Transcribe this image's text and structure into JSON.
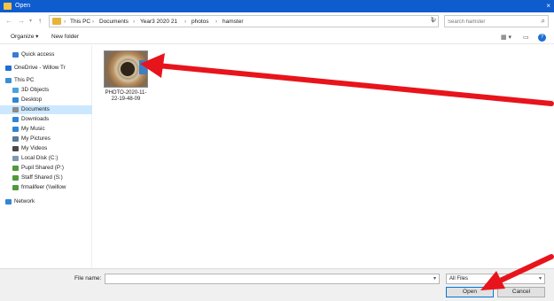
{
  "window": {
    "title": "Open",
    "close_glyph": "×"
  },
  "nav": {
    "back": "←",
    "forward": "→",
    "recent": "▾",
    "up": "↑"
  },
  "breadcrumb": [
    "This PC",
    "Documents",
    "Year3 2020 21",
    "photos",
    "hamster"
  ],
  "breadcrumb_sep": "›",
  "search": {
    "placeholder": "Search hamster"
  },
  "toolbar": {
    "organize": "Organize ▾",
    "new_folder": "New folder",
    "view_glyph": "▦ ▾",
    "pane_glyph": "▭",
    "help_glyph": "?"
  },
  "sidebar": {
    "items": [
      {
        "label": "Quick access",
        "icon": "star-icon",
        "color": "#3a7bd5"
      },
      {
        "label": "OneDrive - Willow Tr",
        "icon": "cloud-icon",
        "color": "#1f6fd1"
      },
      {
        "label": "This PC",
        "icon": "computer-icon",
        "color": "#3a8fd6"
      },
      {
        "label": "3D Objects",
        "icon": "cube-icon",
        "color": "#4aa3df"
      },
      {
        "label": "Desktop",
        "icon": "desktop-icon",
        "color": "#2f86d6"
      },
      {
        "label": "Documents",
        "icon": "document-icon",
        "color": "#8a8a8a"
      },
      {
        "label": "Downloads",
        "icon": "download-icon",
        "color": "#2f86d6"
      },
      {
        "label": "My Music",
        "icon": "music-icon",
        "color": "#2f86d6"
      },
      {
        "label": "My Pictures",
        "icon": "pictures-icon",
        "color": "#5c7a99"
      },
      {
        "label": "My Videos",
        "icon": "video-icon",
        "color": "#4a4a4a"
      },
      {
        "label": "Local Disk (C:)",
        "icon": "disk-icon",
        "color": "#7e98b5"
      },
      {
        "label": "Pupil Shared (P:)",
        "icon": "network-drive-icon",
        "color": "#4f9a3a"
      },
      {
        "label": "Staff Shared (S:)",
        "icon": "network-drive-icon",
        "color": "#4f9a3a"
      },
      {
        "label": "frmalifeer (\\\\willow",
        "icon": "network-drive-icon",
        "color": "#4f9a3a"
      },
      {
        "label": "Network",
        "icon": "network-icon",
        "color": "#2f86d6"
      }
    ],
    "selected_index": 5
  },
  "files": [
    {
      "name": "PHOTO-2020-11-22-19-48-09",
      "line1": "PHOTO-2020-11-",
      "line2": "22-19-48-09"
    }
  ],
  "bottom": {
    "file_name_label": "File name:",
    "file_name_value": "",
    "filter": "All Files",
    "open_label": "Open",
    "cancel_label": "Cancel"
  },
  "annotation_color": "#e8141b"
}
